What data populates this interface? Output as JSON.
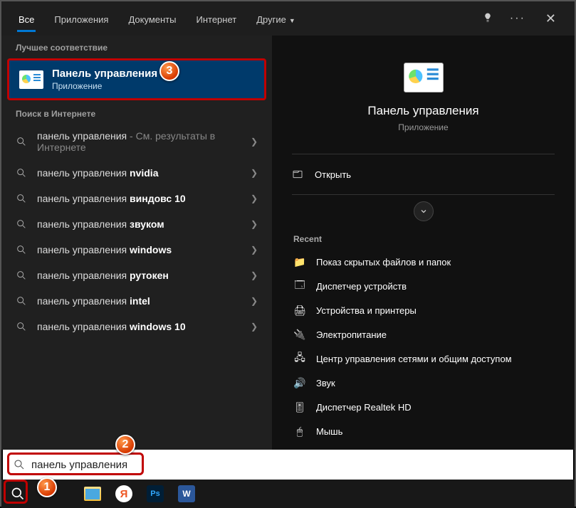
{
  "tabs": {
    "all": "Все",
    "apps": "Приложения",
    "docs": "Документы",
    "internet": "Интернет",
    "other": "Другие"
  },
  "sections": {
    "best": "Лучшее соответствие",
    "web": "Поиск в Интернете",
    "recent": "Recent"
  },
  "best": {
    "title": "Панель управления",
    "sub": "Приложение"
  },
  "suggestions": [
    {
      "pre": "панель управления",
      "bold": "",
      "note": " - См. результаты в Интернете"
    },
    {
      "pre": "панель управления ",
      "bold": "nvidia",
      "note": ""
    },
    {
      "pre": "панель управления ",
      "bold": "виндовс 10",
      "note": ""
    },
    {
      "pre": "панель управления ",
      "bold": "звуком",
      "note": ""
    },
    {
      "pre": "панель управления ",
      "bold": "windows",
      "note": ""
    },
    {
      "pre": "панель управления ",
      "bold": "рутокен",
      "note": ""
    },
    {
      "pre": "панель управления ",
      "bold": "intel",
      "note": ""
    },
    {
      "pre": "панель управления ",
      "bold": "windows 10",
      "note": ""
    }
  ],
  "preview": {
    "title": "Панель управления",
    "sub": "Приложение",
    "open": "Открыть"
  },
  "recent": [
    {
      "icon": "folder-icon",
      "glyph": "📁",
      "label": "Показ скрытых файлов и папок"
    },
    {
      "icon": "task-manager-icon",
      "glyph": "🗔",
      "label": "Диспетчер устройств"
    },
    {
      "icon": "printer-icon",
      "glyph": "🖨",
      "label": "Устройства и принтеры"
    },
    {
      "icon": "power-icon",
      "glyph": "🔌",
      "label": "Электропитание"
    },
    {
      "icon": "network-icon",
      "glyph": "🖧",
      "label": "Центр управления сетями и общим доступом"
    },
    {
      "icon": "sound-icon",
      "glyph": "🔊",
      "label": "Звук"
    },
    {
      "icon": "realtek-icon",
      "glyph": "🎚",
      "label": "Диспетчер Realtek HD"
    },
    {
      "icon": "mouse-icon",
      "glyph": "🖱",
      "label": "Мышь"
    }
  ],
  "search_value": "панель управления",
  "badges": {
    "b1": "1",
    "b2": "2",
    "b3": "3"
  }
}
